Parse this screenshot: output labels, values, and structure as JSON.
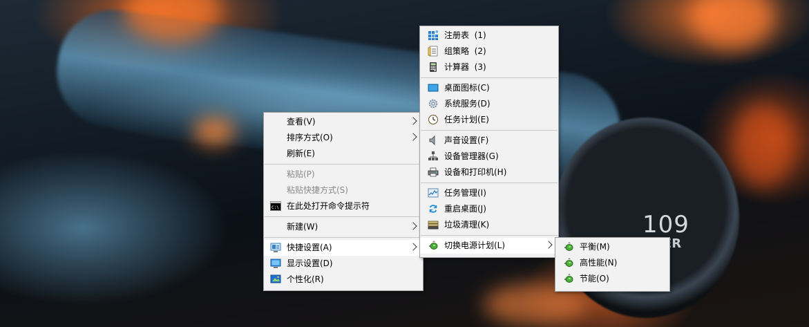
{
  "wallpaper": {
    "knob_text": "109",
    "knob_subtext": "ER"
  },
  "context_menu": {
    "items": [
      {
        "label": "查看(V)",
        "submenu": true
      },
      {
        "label": "排序方式(O)",
        "submenu": true
      },
      {
        "label": "刷新(E)"
      },
      {
        "label": "粘贴(P)",
        "disabled": true
      },
      {
        "label": "粘贴快捷方式(S)",
        "disabled": true
      },
      {
        "label": "在此处打开命令提示符",
        "icon": "cmd-icon"
      },
      {
        "label": "新建(W)",
        "submenu": true
      },
      {
        "label": "快捷设置(A)",
        "icon": "quick-settings-icon",
        "submenu": true
      },
      {
        "label": "显示设置(D)",
        "icon": "display-icon"
      },
      {
        "label": "个性化(R)",
        "icon": "personalize-icon"
      }
    ]
  },
  "quick_settings_menu": {
    "items": [
      {
        "label": "注册表",
        "shortcut": "(1)",
        "icon": "registry-icon"
      },
      {
        "label": "组策略",
        "shortcut": "(2)",
        "icon": "group-policy-icon"
      },
      {
        "label": "计算器",
        "shortcut": "(3)",
        "icon": "calculator-icon"
      },
      {
        "label": "桌面图标(C)",
        "icon": "desktop-icon"
      },
      {
        "label": "系统服务(D)",
        "icon": "services-gear-icon"
      },
      {
        "label": "任务计划(E)",
        "icon": "clock-icon"
      },
      {
        "label": "声音设置(F)",
        "icon": "speaker-icon"
      },
      {
        "label": "设备管理器(G)",
        "icon": "device-manager-icon"
      },
      {
        "label": "设备和打印机(H)",
        "icon": "printer-icon"
      },
      {
        "label": "任务管理(I)",
        "icon": "task-manager-icon"
      },
      {
        "label": "重启桌面(J)",
        "icon": "refresh-icon"
      },
      {
        "label": "垃圾清理(K)",
        "icon": "cleanup-icon"
      },
      {
        "label": "切换电源计划(L)",
        "icon": "power-plan-icon",
        "submenu": true
      }
    ]
  },
  "power_plan_menu": {
    "items": [
      {
        "label": "平衡(M)",
        "icon": "power-plan-icon"
      },
      {
        "label": "高性能(N)",
        "icon": "power-plan-icon"
      },
      {
        "label": "节能(O)",
        "icon": "power-plan-icon"
      }
    ]
  },
  "colors": {
    "menu_bg": "#f2f2f2",
    "highlight": "#ffffff",
    "disabled_text": "#8a8a8a",
    "separator": "#c8c8c8"
  }
}
